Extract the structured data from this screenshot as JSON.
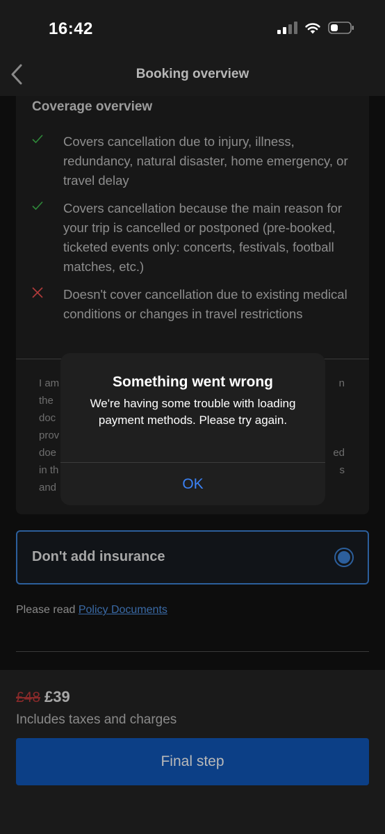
{
  "status_bar": {
    "time": "16:42"
  },
  "header": {
    "title": "Booking overview"
  },
  "coverage": {
    "title": "Coverage overview",
    "items": [
      {
        "type": "check",
        "text": "Covers cancellation due to injury, illness, redundancy, natural disaster, home emergency, or travel delay"
      },
      {
        "type": "check",
        "text": "Covers cancellation because the main reason for your trip is cancelled or postponed (pre-booked, ticketed events only: concerts, festivals, football matches, etc.)"
      },
      {
        "type": "cross",
        "text": "Doesn't cover cancellation due to existing medical conditions or changes in travel restrictions"
      }
    ],
    "terms_fragments": [
      "I am",
      "n",
      "the",
      "doc",
      "prov",
      "doe",
      "ed",
      "in th",
      "s",
      "and"
    ]
  },
  "option": {
    "label": "Don't add insurance"
  },
  "policy": {
    "prefix": "Please read",
    "link": "Policy Documents"
  },
  "footer": {
    "old_price": "£48",
    "new_price": "£39",
    "tax_note": "Includes taxes and charges",
    "button_label": "Final step"
  },
  "alert": {
    "title": "Something went wrong",
    "message": "We're having some trouble with loading payment methods. Please try again.",
    "ok_label": "OK"
  },
  "colors": {
    "accent": "#3b82f6",
    "primary_button": "#0c3f86",
    "check": "#2f8a3a",
    "cross": "#b23b3b",
    "old_price": "#8a2a2a"
  }
}
